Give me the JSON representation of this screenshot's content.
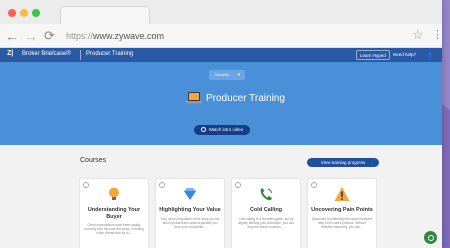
{
  "browser": {
    "url_protocol": "https://",
    "url_host": "www.zywave.com",
    "nav": {
      "back": "←",
      "forward": "→",
      "reload": "⟳"
    },
    "icons": {
      "bookmark": "star-icon",
      "menu": "kebab-menu-icon"
    }
  },
  "appbar": {
    "logo": "Z|",
    "brand": "Broker Briefcase®",
    "section": "Producer Training",
    "learn_label": "Learn Hyped",
    "help_label": "Need help?",
    "user_label": "👤"
  },
  "hero": {
    "select_label": "Generic",
    "title": "Producer Training",
    "watch_label": "Watch intro video"
  },
  "courses": {
    "title": "Courses",
    "progress_label": "View training progress",
    "cards": [
      {
        "title": "Understanding Your Buyer",
        "desc": "Client expectations have been rapidly evolving over the past few years. Knowing when clients look for in..."
      },
      {
        "title": "Highlighting Your Value",
        "desc": "Your value proposition is the story you tell about yourself and what separates you from your competitio..."
      },
      {
        "title": "Cold Calling",
        "desc": "Cold calling is a numbers game, but by slightly altering your technique, you can improve these numbers ..."
      },
      {
        "title": "Uncovering Pain Points",
        "desc": "Discovery is potentially the most important step of the sales process. Without effective discovery, you can..."
      }
    ]
  },
  "colors": {
    "appbar": "#2a5aa6",
    "hero": "#4a90d8",
    "primary_button": "#1f4f9e",
    "chat": "#2f8a3c",
    "background": "#7d6ab8"
  }
}
